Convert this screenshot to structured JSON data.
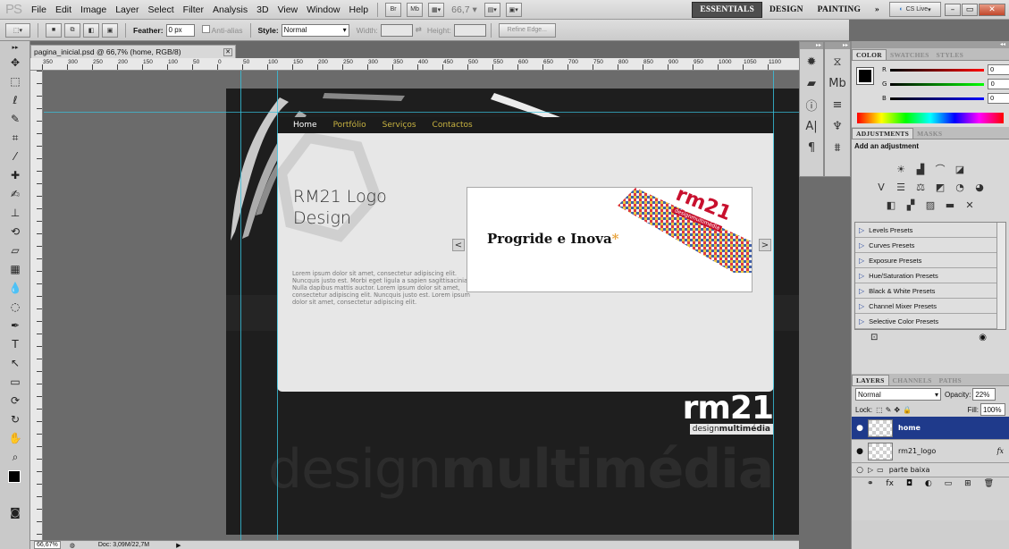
{
  "menubar": {
    "logo": "PS",
    "items": [
      "File",
      "Edit",
      "Image",
      "Layer",
      "Select",
      "Filter",
      "Analysis",
      "3D",
      "View",
      "Window",
      "Help"
    ],
    "bridge_btn": "Br",
    "minibridge_btn": "Mb",
    "zoom": "66,7",
    "workspaces": [
      "ESSENTIALS",
      "DESIGN",
      "PAINTING"
    ],
    "more": "»",
    "cslive": "CS Live"
  },
  "options": {
    "feather_label": "Feather:",
    "feather_value": "0 px",
    "antialias_label": "Anti-alias",
    "style_label": "Style:",
    "style_value": "Normal",
    "width_label": "Width:",
    "height_label": "Height:",
    "refine_label": "Refine Edge..."
  },
  "document": {
    "tab_title": "pagina_inicial.psd @ 66,7% (home, RGB/8)",
    "status_zoom": "66,67%",
    "status_doc": "Doc: 3,09M/22,7M"
  },
  "ruler": {
    "h_ticks": [
      "350",
      "300",
      "250",
      "200",
      "150",
      "100",
      "50",
      "0",
      "50",
      "100",
      "150",
      "200",
      "250",
      "300",
      "350",
      "400",
      "450",
      "500",
      "550",
      "600",
      "650",
      "700",
      "750",
      "800",
      "850",
      "900",
      "950",
      "1000",
      "1050",
      "1100"
    ]
  },
  "site": {
    "nav": [
      "Home",
      "Portfólio",
      "Serviços",
      "Contactos"
    ],
    "title_line1": "RM21 Logo",
    "title_line2": "Design",
    "lorem": "Lorem ipsum dolor sit amet, consectetur adipiscing elit. Nuncquis justo est. Morbi eget ligula a sapien sagittisacinia. Nulla dapibus mattis auctor. Lorem ipsum dolor sit amet, consectetur adipiscing elit. Nuncquis justo est. Lorem ipsum dolor sit amet, consectetur adipiscing elit.",
    "slide_text": "Progride e Inova",
    "slide_star": "*",
    "slide_logo": "rm21",
    "slide_logo_sub": "designmultimédia",
    "prev": "<",
    "next": ">",
    "brand_big": "rm21",
    "brand_small_a": "design",
    "brand_small_b": "multimédia",
    "watermark_a": "design",
    "watermark_b": "multimédia"
  },
  "color_panel": {
    "tabs": [
      "COLOR",
      "SWATCHES",
      "STYLES"
    ],
    "r_label": "R",
    "g_label": "G",
    "b_label": "B",
    "r_value": "0",
    "g_value": "0",
    "b_value": "0"
  },
  "adjust_panel": {
    "tabs": [
      "ADJUSTMENTS",
      "MASKS"
    ],
    "heading": "Add an adjustment",
    "presets": [
      "Levels Presets",
      "Curves Presets",
      "Exposure Presets",
      "Hue/Saturation Presets",
      "Black & White Presets",
      "Channel Mixer Presets",
      "Selective Color Presets"
    ]
  },
  "layers_panel": {
    "tabs": [
      "LAYERS",
      "CHANNELS",
      "PATHS"
    ],
    "blend_mode": "Normal",
    "opacity_label": "Opacity:",
    "opacity_value": "22%",
    "lock_label": "Lock:",
    "fill_label": "Fill:",
    "fill_value": "100%",
    "layers": [
      {
        "name": "home"
      },
      {
        "name": "rm21_logo",
        "fx": "fx"
      },
      {
        "name": "parte baixa"
      }
    ]
  }
}
